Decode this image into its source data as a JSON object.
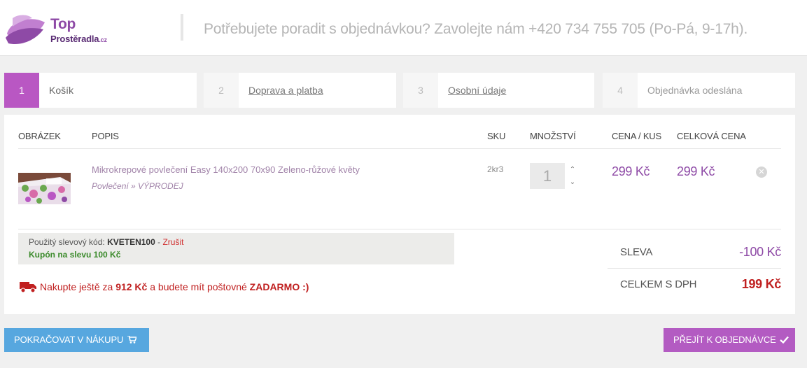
{
  "logo": {
    "top": "Top",
    "bottom": "Prostěradla",
    "cz": ".cz"
  },
  "header": {
    "contact": "Potřebujete poradit s objednávkou? Zavolejte nám +420 734 755 705 (Po-Pá, 9-17h)."
  },
  "steps": [
    {
      "num": "1",
      "label": "Košík"
    },
    {
      "num": "2",
      "label": "Doprava a platba"
    },
    {
      "num": "3",
      "label": "Osobní údaje"
    },
    {
      "num": "4",
      "label": "Objednávka odeslána"
    }
  ],
  "table": {
    "headers": {
      "image": "OBRÁZEK",
      "desc": "POPIS",
      "sku": "SKU",
      "qty": "MNOŽSTVÍ",
      "unit_price": "CENA / KUS",
      "total": "CELKOVÁ CENA"
    }
  },
  "item": {
    "name": "Mikrokrepové povlečení Easy 140x200 70x90 Zeleno-růžové květy",
    "category": "Povlečení » VÝPRODEJ",
    "sku": "2kr3",
    "quantity": "1",
    "unit_price": "299 Kč",
    "total": "299 Kč"
  },
  "coupon": {
    "used_label": "Použitý slevový kód:",
    "code": "KVETEN100",
    "separator": " - ",
    "cancel": "Zrušit",
    "description": "Kupón na slevu 100 Kč"
  },
  "shipping": {
    "pre": "Nakupte ještě za",
    "amount": "912 Kč",
    "mid": "a budete mít poštovné",
    "free": "ZADARMO :)"
  },
  "summary": {
    "discount_label": "SLEVA",
    "discount_value": "-100 Kč",
    "total_label": "CELKEM S DPH",
    "total_value": "199 Kč"
  },
  "buttons": {
    "continue": "POKRAČOVAT V NÁKUPU",
    "order": "PŘEJÍT K OBJEDNÁVCE"
  },
  "colors": {
    "accent": "#b957c3",
    "price": "#8e4aa6",
    "blue": "#57a7df",
    "red": "#c02020",
    "green": "#3a8a2a"
  },
  "icons": [
    "leaf-logo-icon",
    "chevron-up-icon",
    "chevron-down-icon",
    "remove-icon",
    "truck-icon",
    "cart-icon",
    "check-icon"
  ]
}
